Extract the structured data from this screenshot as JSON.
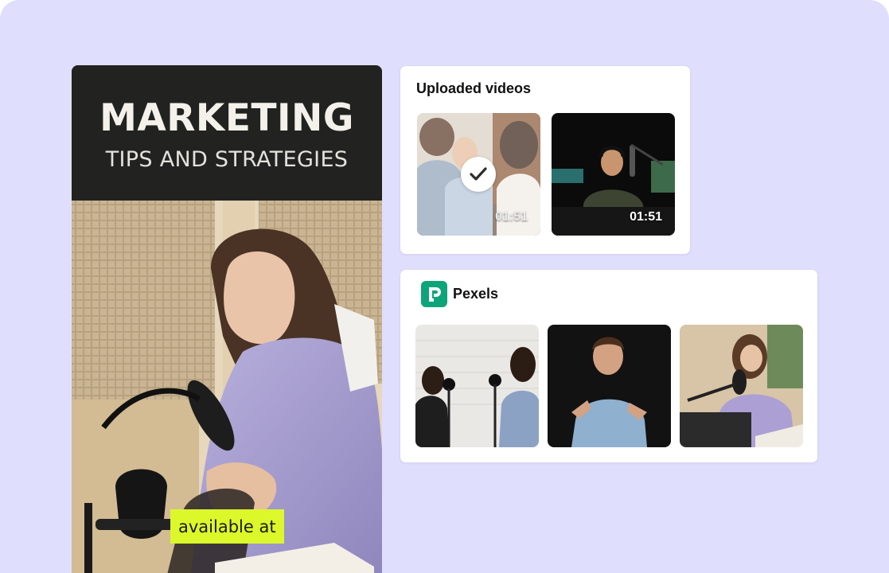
{
  "story": {
    "title": "MARKETING",
    "subtitle": "TIPS AND STRATEGIES",
    "badge": "available at",
    "photo_icon": "podcast-woman-photo"
  },
  "uploaded": {
    "title": "Uploaded videos",
    "videos": [
      {
        "duration": "01:51",
        "selected": true,
        "thumb_icon": "friends-laughing-thumbnail"
      },
      {
        "duration": "01:51",
        "selected": false,
        "thumb_icon": "podcast-host-thumbnail"
      }
    ],
    "check_icon": "checkmark-icon"
  },
  "pexels": {
    "title": "Pexels",
    "logo_icon": "pexels-logo-icon",
    "videos": [
      {
        "thumb_icon": "podcast-two-women-thumbnail"
      },
      {
        "thumb_icon": "man-speaking-thumbnail"
      },
      {
        "thumb_icon": "woman-podcast-thumbnail"
      }
    ]
  },
  "colors": {
    "background": "#e0defd",
    "story_header": "#222220",
    "badge": "#dcf82a",
    "pexels_brand": "#0ea47a"
  }
}
